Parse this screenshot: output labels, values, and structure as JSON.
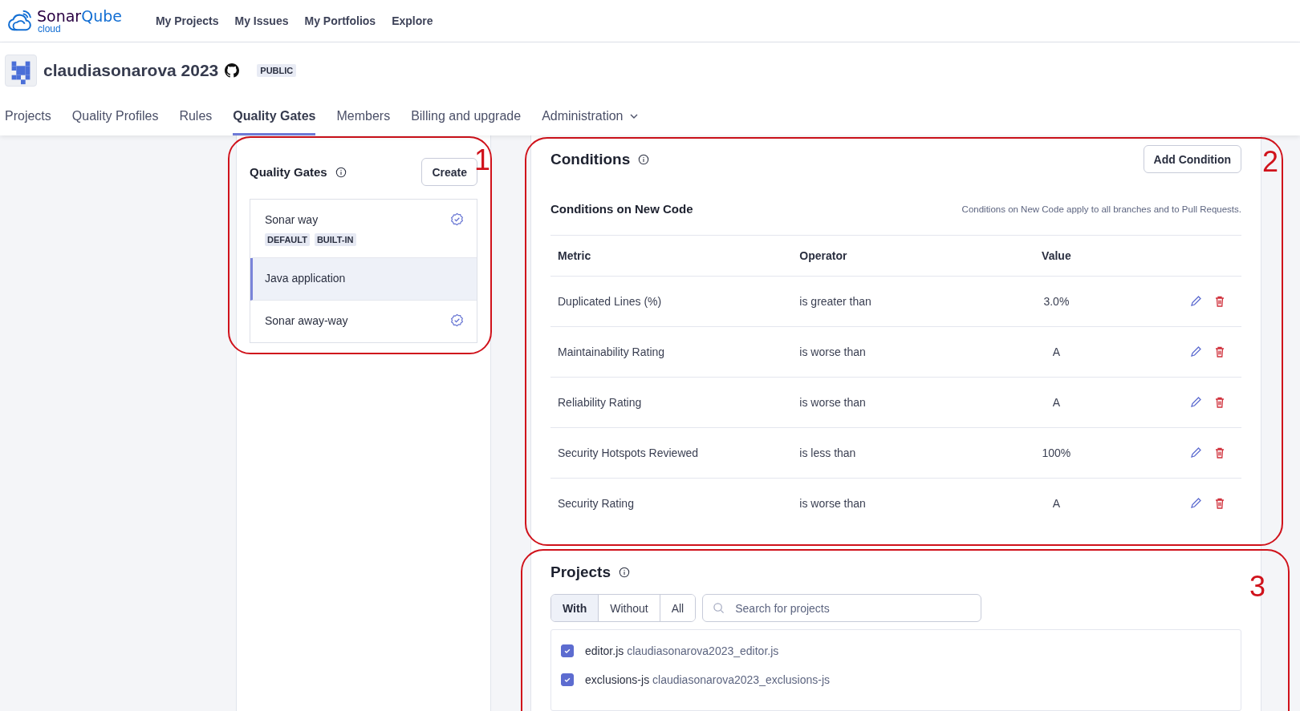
{
  "brand": {
    "words": [
      "Sonar",
      "Qube"
    ],
    "sub": "cloud"
  },
  "nav": [
    "My Projects",
    "My Issues",
    "My Portfolios",
    "Explore"
  ],
  "org": {
    "name": "claudiasonarova 2023",
    "visibility": "PUBLIC"
  },
  "tabs": [
    {
      "label": "Projects",
      "selected": false,
      "kind": "link"
    },
    {
      "label": "Quality Profiles",
      "selected": false,
      "kind": "link"
    },
    {
      "label": "Rules",
      "selected": false,
      "kind": "link"
    },
    {
      "label": "Quality Gates",
      "selected": true,
      "kind": "link"
    },
    {
      "label": "Members",
      "selected": false,
      "kind": "link"
    },
    {
      "label": "Billing and upgrade",
      "selected": false,
      "kind": "link"
    },
    {
      "label": "Administration",
      "selected": false,
      "kind": "menu"
    }
  ],
  "quality_gates": {
    "title": "Quality Gates",
    "create_button": "Create",
    "annotation": "1",
    "gates": [
      {
        "name": "Sonar way",
        "selected": false,
        "verified": true,
        "badges": [
          "DEFAULT",
          "BUILT-IN"
        ]
      },
      {
        "name": "Java application",
        "selected": true,
        "verified": false
      },
      {
        "name": "Sonar away-way",
        "selected": false,
        "verified": true
      }
    ]
  },
  "conditions": {
    "title": "Conditions",
    "add_button": "Add Condition",
    "annotation": "2",
    "section_title": "Conditions on New Code",
    "note": "Conditions on New Code apply to all branches and to Pull Requests.",
    "columns": [
      "Metric",
      "Operator",
      "Value"
    ],
    "rows": [
      {
        "metric": "Duplicated Lines (%)",
        "operator": "is greater than",
        "value": "3.0%"
      },
      {
        "metric": "Maintainability Rating",
        "operator": "is worse than",
        "value": "A"
      },
      {
        "metric": "Reliability Rating",
        "operator": "is worse than",
        "value": "A"
      },
      {
        "metric": "Security Hotspots Reviewed",
        "operator": "is less than",
        "value": "100%"
      },
      {
        "metric": "Security Rating",
        "operator": "is worse than",
        "value": "A"
      }
    ]
  },
  "projects": {
    "title": "Projects",
    "annotation": "3",
    "filters": [
      {
        "label": "With",
        "selected": true
      },
      {
        "label": "Without",
        "selected": false
      },
      {
        "label": "All",
        "selected": false
      }
    ],
    "search": {
      "placeholder": "Search for projects"
    },
    "items": [
      {
        "name": "editor.js",
        "key": "claudiasonarova2023_editor.js",
        "checked": true
      },
      {
        "name": "exclusions-js",
        "key": "claudiasonarova2023_exclusions-js",
        "checked": true
      }
    ]
  }
}
